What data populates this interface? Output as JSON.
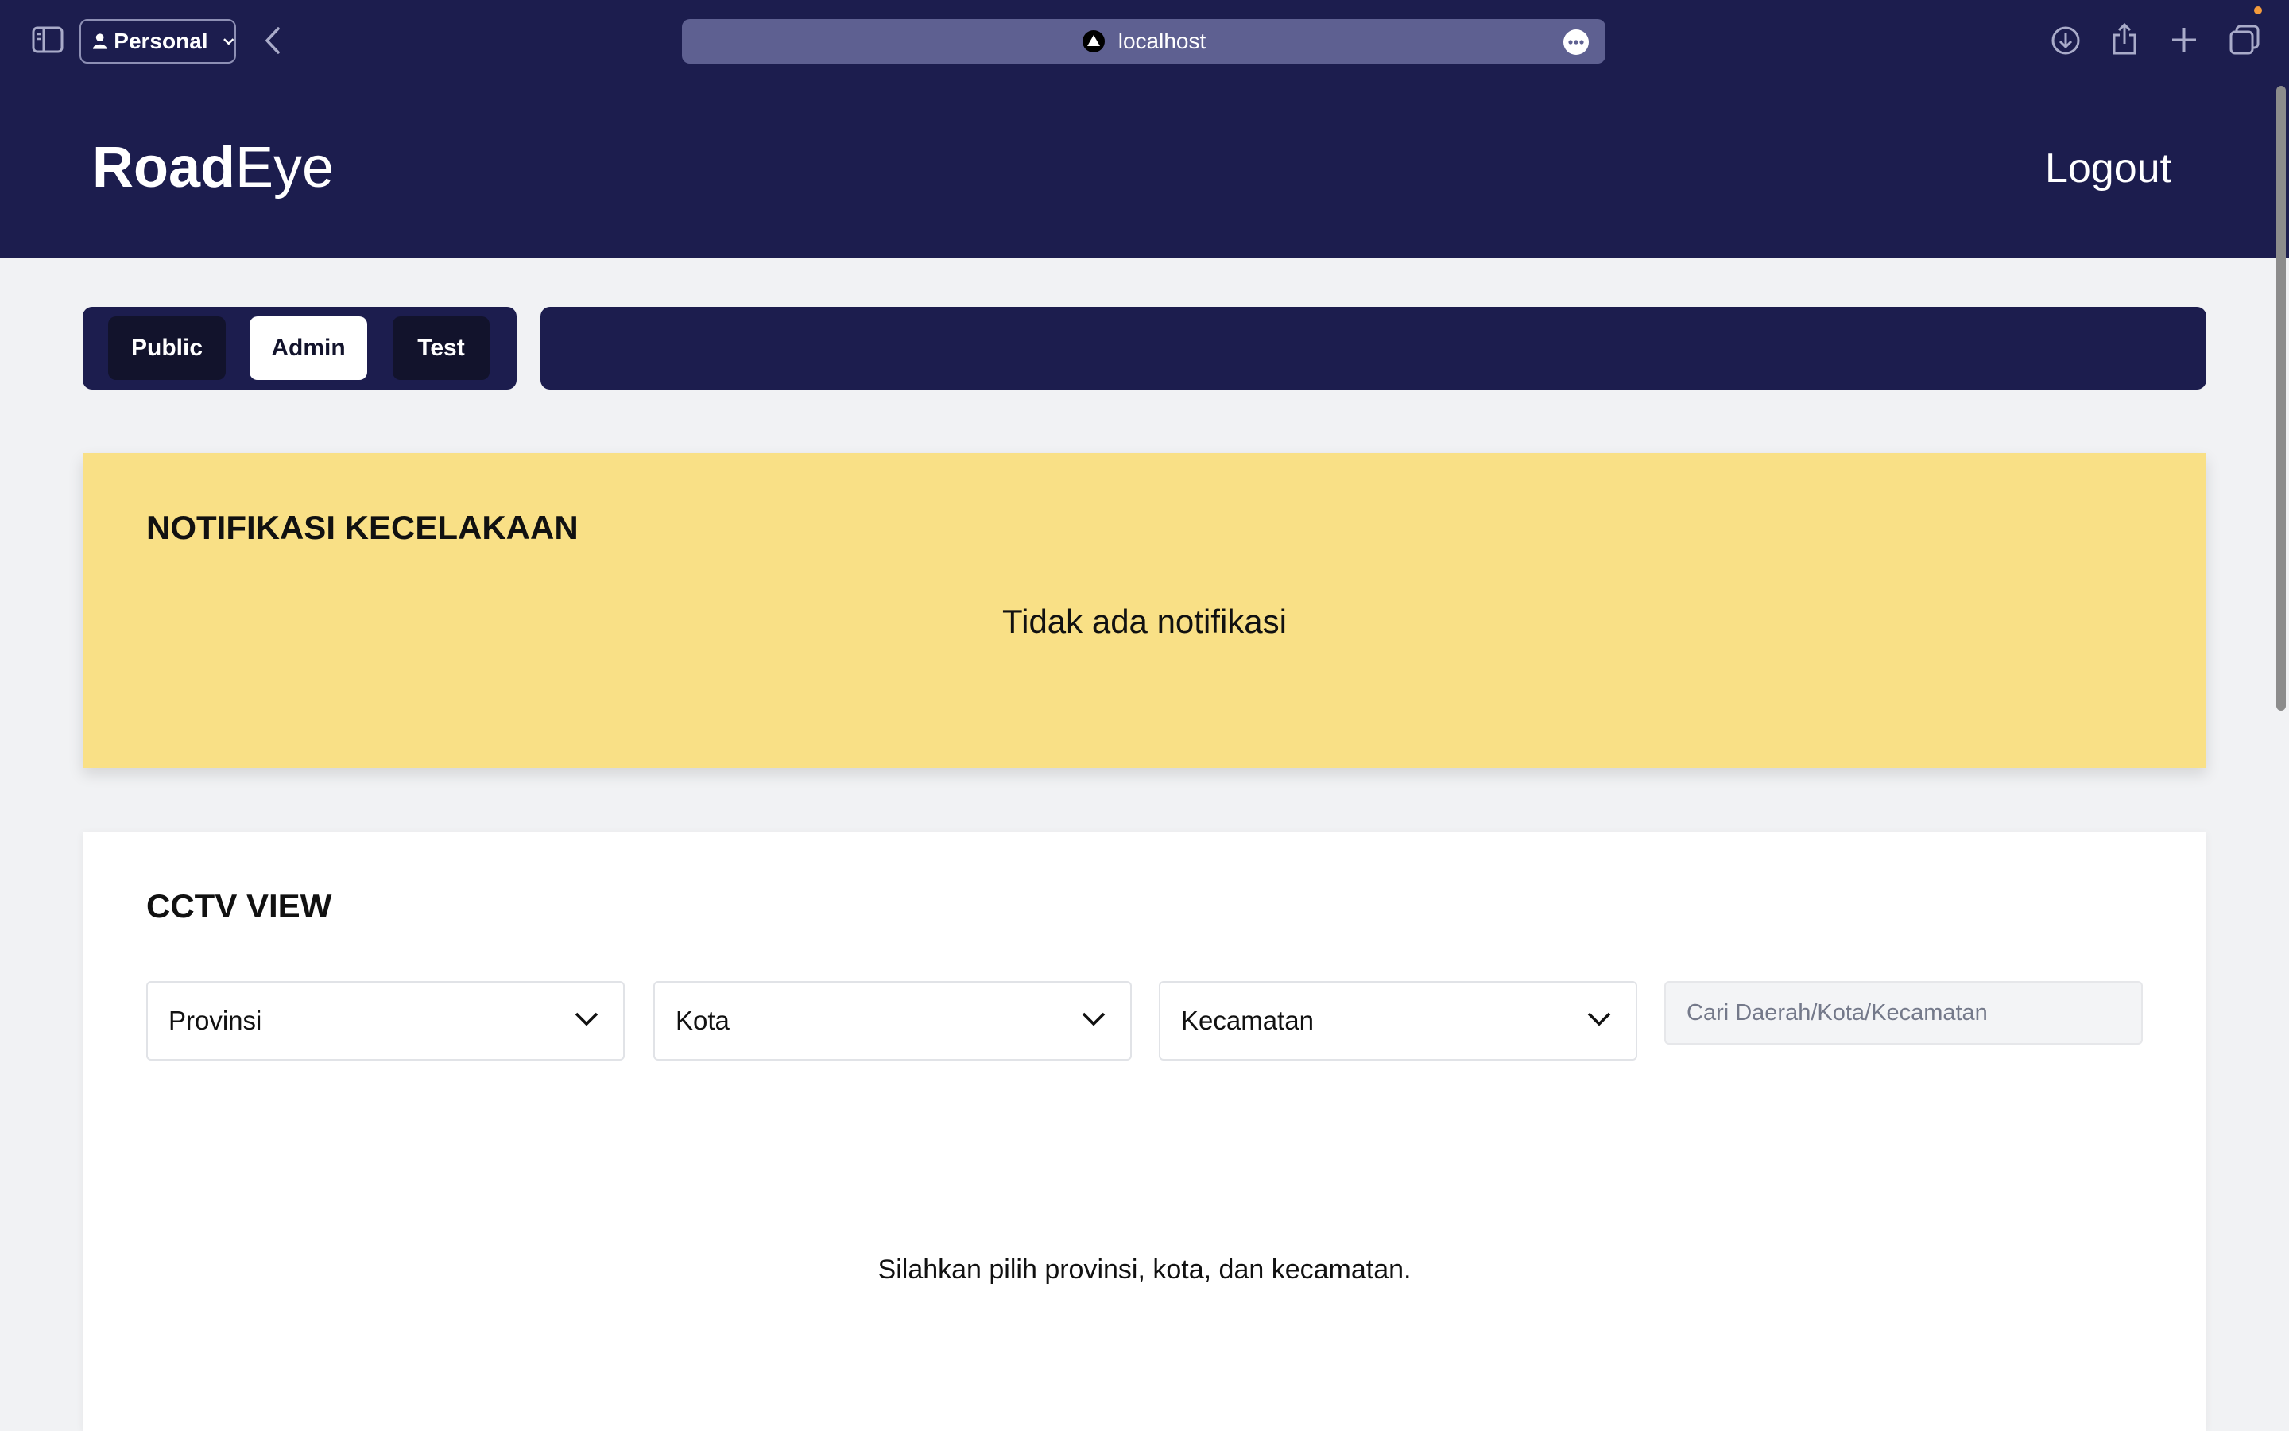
{
  "browser": {
    "profile_label": "Personal",
    "url": "localhost",
    "accent_dot_color": "#f49b3b"
  },
  "app": {
    "brand_bold": "Road",
    "brand_light": "Eye",
    "logout_label": "Logout",
    "header_color": "#1c1d4e"
  },
  "role_tabs": [
    {
      "label": "Public",
      "active": false
    },
    {
      "label": "Admin",
      "active": true
    },
    {
      "label": "Test",
      "active": false
    }
  ],
  "notification": {
    "title": "NOTIFIKASI KECELAKAAN",
    "empty_text": "Tidak ada notifikasi",
    "background_color": "#f9e086"
  },
  "cctv": {
    "title": "CCTV VIEW",
    "province_select": "Provinsi",
    "city_select": "Kota",
    "district_select": "Kecamatan",
    "search_placeholder": "Cari Daerah/Kota/Kecamatan",
    "empty_text": "Silahkan pilih provinsi, kota, dan kecamatan."
  },
  "icons": [
    "sidebar-icon",
    "person-icon",
    "chevron-down-icon",
    "back-icon",
    "site-icon",
    "more-icon",
    "download-icon",
    "share-icon",
    "plus-icon",
    "tabs-icon"
  ]
}
